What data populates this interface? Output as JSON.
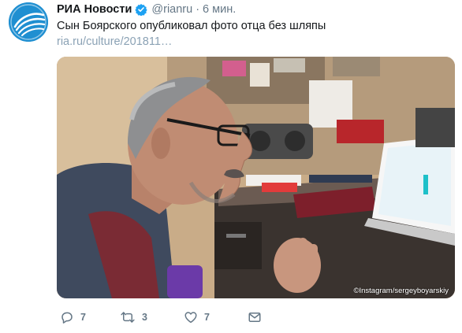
{
  "tweet": {
    "author_name": "РИА Новости",
    "handle": "@rianru",
    "separator": "·",
    "time": "6 мин.",
    "text": "Сын Боярского опубликовал фото отца без шляпы",
    "link": "ria.ru/culture/201811…",
    "media": {
      "credit": "©Instagram/sergeyboyarskiy"
    }
  },
  "actions": {
    "replies": "7",
    "retweets": "3",
    "likes": "7"
  },
  "icons": {
    "avatar": "ria-logo-icon",
    "verified": "verified-badge-icon",
    "reply": "reply-icon",
    "retweet": "retweet-icon",
    "like": "heart-icon",
    "dm": "envelope-icon"
  },
  "colors": {
    "brand_blue": "#1f8fd1",
    "verified": "#1da1f2",
    "secondary_text": "#657786",
    "link": "#8ba2b5"
  }
}
